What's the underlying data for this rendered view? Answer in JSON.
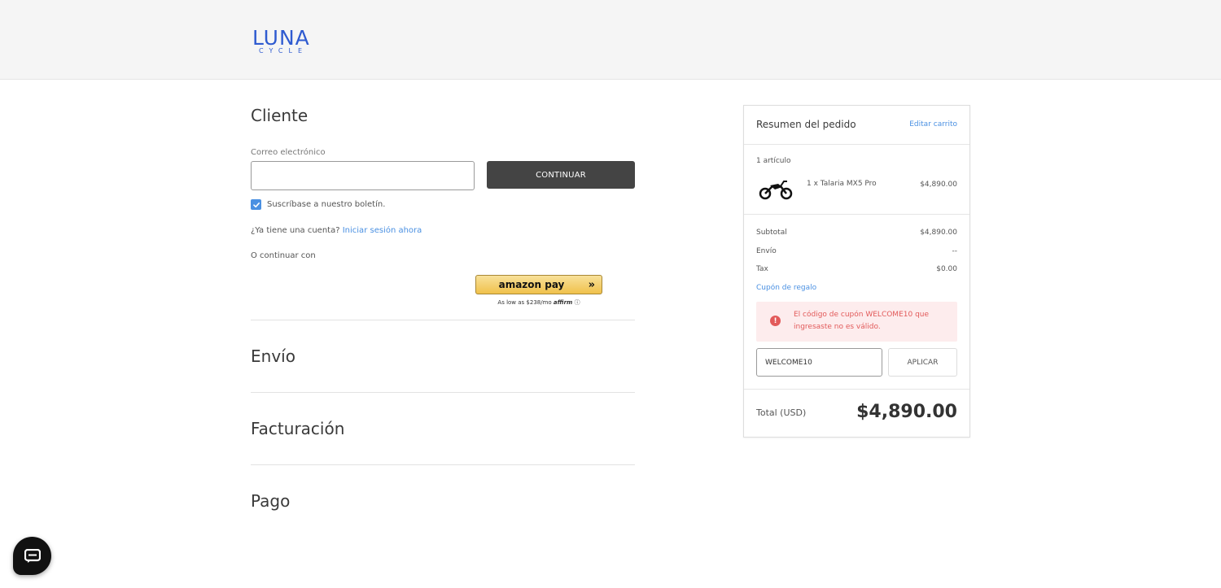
{
  "brand": {
    "name": "LUNA",
    "sub": "CYCLE",
    "color": "#2f5bd0"
  },
  "customer": {
    "title": "Cliente",
    "email_label": "Correo electrónico",
    "email_value": "",
    "continue_label": "CONTINUAR",
    "newsletter_label": "Suscríbase a nuestro boletín.",
    "newsletter_checked": true,
    "account_prompt": "¿Ya tiene una cuenta?",
    "login_link": "Iniciar sesión ahora",
    "or_continue": "O continuar con",
    "amazon_pay_label": "amazon pay",
    "affirm_text": "As low as $238/mo",
    "affirm_logo": "affirm"
  },
  "sections": {
    "shipping": "Envío",
    "billing": "Facturación",
    "payment": "Pago"
  },
  "summary": {
    "title": "Resumen del pedido",
    "edit_cart": "Editar carrito",
    "items_count": "1 artículo",
    "item_name": "1 x Talaria MX5 Pro",
    "item_price": "$4,890.00",
    "subtotal_label": "Subtotal",
    "subtotal_value": "$4,890.00",
    "shipping_label": "Envío",
    "shipping_value": "--",
    "tax_label": "Tax",
    "tax_value": "$0.00",
    "gift_link": "Cupón de regalo",
    "error_message": "El código de cupón WELCOME10 que ingresaste no es válido.",
    "coupon_value": "WELCOME10",
    "apply_label": "APLICAR",
    "total_label": "Total (USD)",
    "total_value": "$4,890.00"
  },
  "colors": {
    "accent": "#4a90e2",
    "error": "#e25a5a",
    "button_dark": "#444444"
  }
}
